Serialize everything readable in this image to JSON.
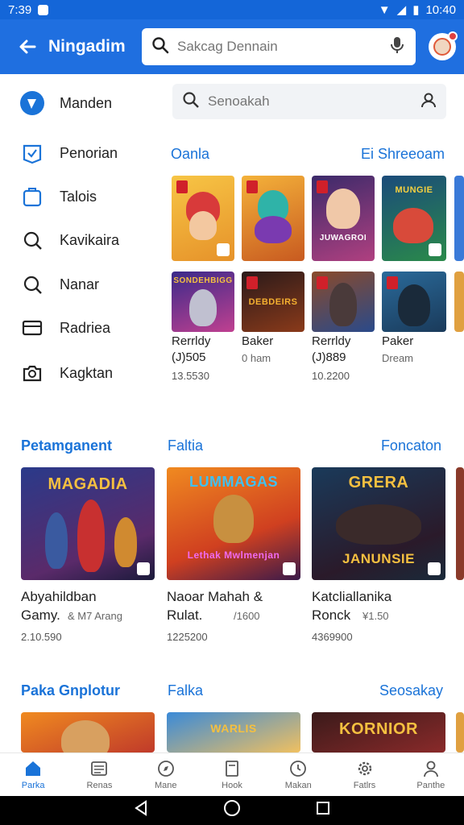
{
  "status": {
    "time": "7:39",
    "clock": "10:40"
  },
  "appbar": {
    "title": "Ningadim",
    "search_placeholder": "Sakcag Dennain"
  },
  "sidebar": {
    "items": [
      {
        "label": "Manden",
        "icon": "shield-check-icon",
        "active": true
      },
      {
        "label": "Penorian",
        "icon": "badge-icon"
      },
      {
        "label": "Talois",
        "icon": "bag-icon"
      },
      {
        "label": "Kavikaira",
        "icon": "search-icon"
      },
      {
        "label": "Nanar",
        "icon": "search-icon"
      },
      {
        "label": "Radriea",
        "icon": "card-icon"
      },
      {
        "label": "Kagktan",
        "icon": "camera-icon"
      }
    ]
  },
  "main": {
    "search_placeholder": "Senoakah",
    "section1": {
      "title": "Oanla",
      "action": "Ei Shreeoam"
    },
    "row1_games": [
      {
        "label": ""
      },
      {
        "label": ""
      },
      {
        "label": "JUWAGROI"
      },
      {
        "label": "MUNGIE"
      }
    ],
    "row2_games": [
      {
        "label": "SONDEHBIGG",
        "name": "Rerrldy",
        "sub": "(J)505",
        "num": "13.5530"
      },
      {
        "label": "DEBDEIRS",
        "name": "Baker",
        "sub": "0 ham",
        "num": ""
      },
      {
        "label": "",
        "name": "Rerrldy",
        "sub": "(J)889",
        "num": "10.2200"
      },
      {
        "label": "",
        "name": "Paker",
        "sub": "Dream",
        "num": ""
      }
    ],
    "section2": {
      "title": "Petamganent",
      "mid": "Faltia",
      "action": "Foncaton"
    },
    "big_games": [
      {
        "label": "MAGADIA",
        "name1": "Abyahildban",
        "name2": "Gamy.",
        "extra": "& M7 Arang",
        "num": "2.10.590"
      },
      {
        "label": "LUMMAGAS",
        "sub_label": "Lethak Mwlmenjan",
        "name1": "Naoar Mahah &",
        "name2": "Rulat.",
        "extra": "/1600",
        "num": "1225200"
      },
      {
        "label": "GRERA",
        "sub_label": "JANUNSIE",
        "name1": "Katcliallanika",
        "name2": "Ronck",
        "extra": "¥1.50",
        "num": "4369900"
      }
    ],
    "section3": {
      "title": "Paka Gnplotur",
      "mid": "Falka",
      "action": "Seosakay"
    },
    "bottom_games": [
      {
        "label": ""
      },
      {
        "label": "WARLIS"
      },
      {
        "label": "KORNIOR"
      }
    ]
  },
  "bottomnav": {
    "items": [
      {
        "label": "Parka",
        "icon": "home-icon",
        "active": true
      },
      {
        "label": "Renas",
        "icon": "list-icon"
      },
      {
        "label": "Mane",
        "icon": "compass-icon"
      },
      {
        "label": "Hook",
        "icon": "book-icon"
      },
      {
        "label": "Makan",
        "icon": "clock-icon"
      },
      {
        "label": "Fatlrs",
        "icon": "gear-icon"
      },
      {
        "label": "Panthe",
        "icon": "person-icon"
      }
    ]
  },
  "colors": {
    "primary": "#1f6fe0",
    "accent": "#1a73d8",
    "status": "#1466d8"
  }
}
